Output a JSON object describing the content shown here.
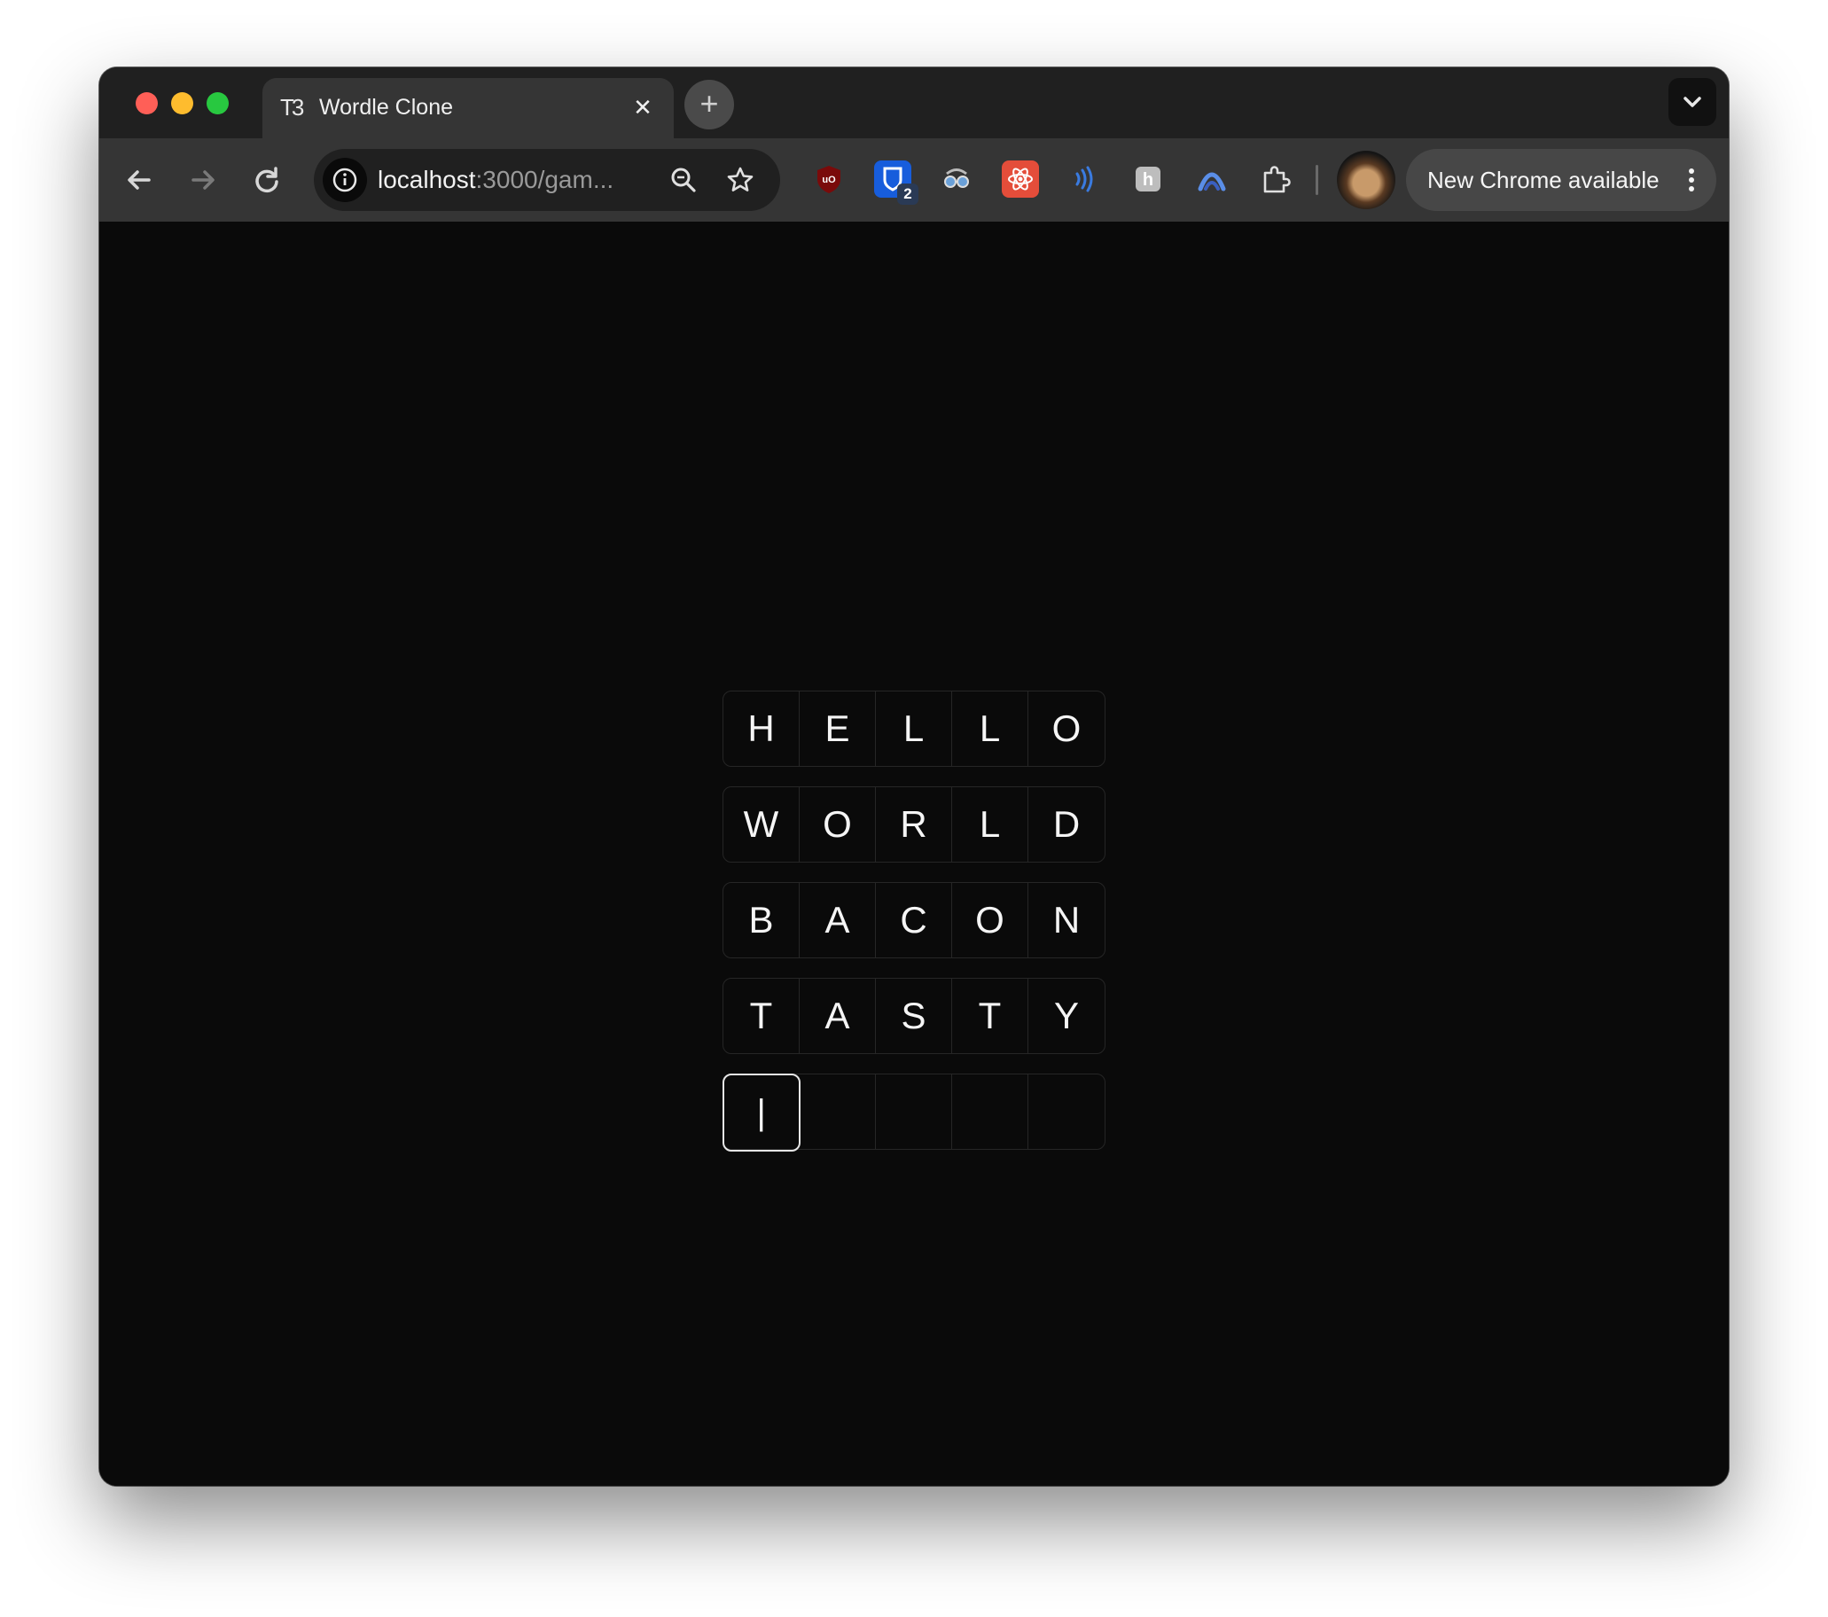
{
  "browser": {
    "tab": {
      "favicon": "T3",
      "title": "Wordle Clone",
      "close_glyph": "✕"
    },
    "new_tab_glyph": "+",
    "address_bar": {
      "host": "localhost",
      "path": ":3000/gam..."
    },
    "update_chip": {
      "label": "New Chrome available"
    },
    "extensions": [
      {
        "name": "ublock-origin-icon",
        "label": "uO",
        "color": "#8b0000"
      },
      {
        "name": "bitwarden-icon",
        "label": "",
        "color": "#175ddc",
        "badge": "2"
      },
      {
        "name": "spy-glasses-icon",
        "label": "",
        "color": "#353535"
      },
      {
        "name": "react-devtools-icon",
        "label": "⚛",
        "color": "#e44d3a"
      },
      {
        "name": "wireless-signal-icon",
        "label": "))",
        "color": "#353535"
      },
      {
        "name": "tool-h-icon",
        "label": "h",
        "color": "#bdbdbd"
      },
      {
        "name": "arc-icon",
        "label": "",
        "color": "#353535"
      },
      {
        "name": "puzzle-piece-icon",
        "label": "",
        "color": "#353535"
      }
    ]
  },
  "game": {
    "rows": [
      [
        "H",
        "E",
        "L",
        "L",
        "O"
      ],
      [
        "W",
        "O",
        "R",
        "L",
        "D"
      ],
      [
        "B",
        "A",
        "C",
        "O",
        "N"
      ],
      [
        "T",
        "A",
        "S",
        "T",
        "Y"
      ],
      [
        "|",
        "",
        "",
        "",
        ""
      ]
    ],
    "active_row": 4,
    "active_col": 0
  }
}
